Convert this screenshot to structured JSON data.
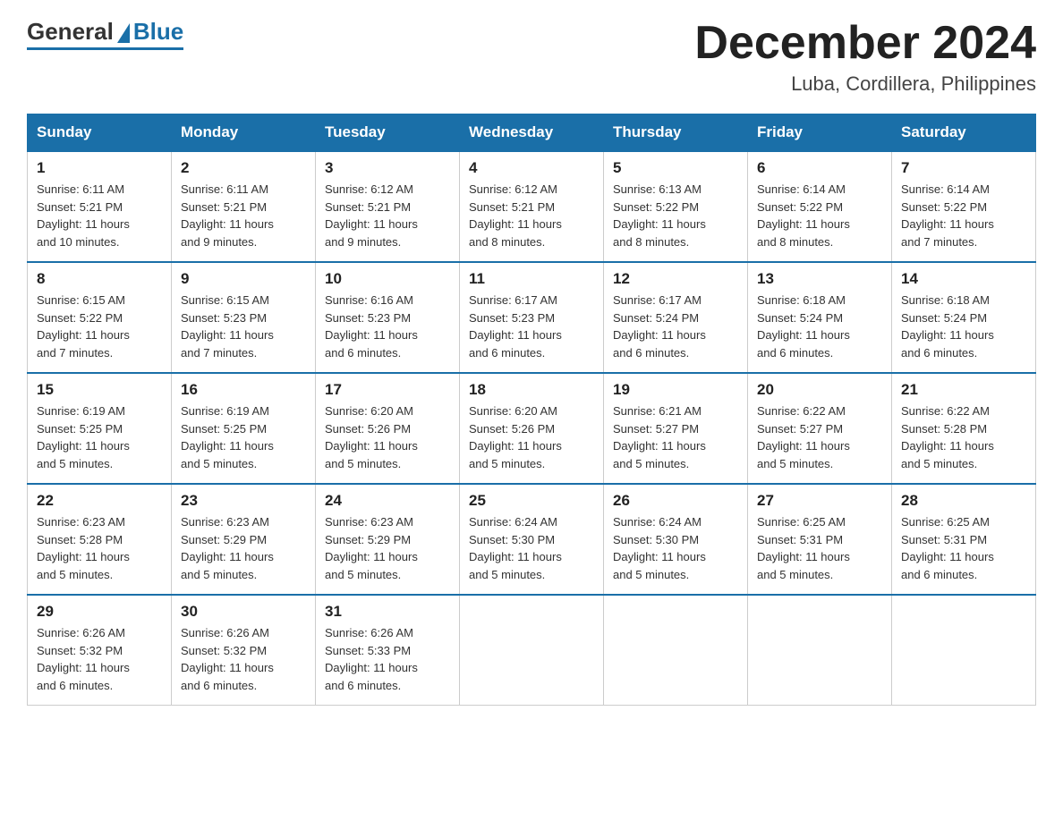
{
  "logo": {
    "general": "General",
    "blue": "Blue"
  },
  "header": {
    "month": "December 2024",
    "location": "Luba, Cordillera, Philippines"
  },
  "days_of_week": [
    "Sunday",
    "Monday",
    "Tuesday",
    "Wednesday",
    "Thursday",
    "Friday",
    "Saturday"
  ],
  "weeks": [
    [
      {
        "day": "1",
        "sunrise": "6:11 AM",
        "sunset": "5:21 PM",
        "daylight": "11 hours and 10 minutes."
      },
      {
        "day": "2",
        "sunrise": "6:11 AM",
        "sunset": "5:21 PM",
        "daylight": "11 hours and 9 minutes."
      },
      {
        "day": "3",
        "sunrise": "6:12 AM",
        "sunset": "5:21 PM",
        "daylight": "11 hours and 9 minutes."
      },
      {
        "day": "4",
        "sunrise": "6:12 AM",
        "sunset": "5:21 PM",
        "daylight": "11 hours and 8 minutes."
      },
      {
        "day": "5",
        "sunrise": "6:13 AM",
        "sunset": "5:22 PM",
        "daylight": "11 hours and 8 minutes."
      },
      {
        "day": "6",
        "sunrise": "6:14 AM",
        "sunset": "5:22 PM",
        "daylight": "11 hours and 8 minutes."
      },
      {
        "day": "7",
        "sunrise": "6:14 AM",
        "sunset": "5:22 PM",
        "daylight": "11 hours and 7 minutes."
      }
    ],
    [
      {
        "day": "8",
        "sunrise": "6:15 AM",
        "sunset": "5:22 PM",
        "daylight": "11 hours and 7 minutes."
      },
      {
        "day": "9",
        "sunrise": "6:15 AM",
        "sunset": "5:23 PM",
        "daylight": "11 hours and 7 minutes."
      },
      {
        "day": "10",
        "sunrise": "6:16 AM",
        "sunset": "5:23 PM",
        "daylight": "11 hours and 6 minutes."
      },
      {
        "day": "11",
        "sunrise": "6:17 AM",
        "sunset": "5:23 PM",
        "daylight": "11 hours and 6 minutes."
      },
      {
        "day": "12",
        "sunrise": "6:17 AM",
        "sunset": "5:24 PM",
        "daylight": "11 hours and 6 minutes."
      },
      {
        "day": "13",
        "sunrise": "6:18 AM",
        "sunset": "5:24 PM",
        "daylight": "11 hours and 6 minutes."
      },
      {
        "day": "14",
        "sunrise": "6:18 AM",
        "sunset": "5:24 PM",
        "daylight": "11 hours and 6 minutes."
      }
    ],
    [
      {
        "day": "15",
        "sunrise": "6:19 AM",
        "sunset": "5:25 PM",
        "daylight": "11 hours and 5 minutes."
      },
      {
        "day": "16",
        "sunrise": "6:19 AM",
        "sunset": "5:25 PM",
        "daylight": "11 hours and 5 minutes."
      },
      {
        "day": "17",
        "sunrise": "6:20 AM",
        "sunset": "5:26 PM",
        "daylight": "11 hours and 5 minutes."
      },
      {
        "day": "18",
        "sunrise": "6:20 AM",
        "sunset": "5:26 PM",
        "daylight": "11 hours and 5 minutes."
      },
      {
        "day": "19",
        "sunrise": "6:21 AM",
        "sunset": "5:27 PM",
        "daylight": "11 hours and 5 minutes."
      },
      {
        "day": "20",
        "sunrise": "6:22 AM",
        "sunset": "5:27 PM",
        "daylight": "11 hours and 5 minutes."
      },
      {
        "day": "21",
        "sunrise": "6:22 AM",
        "sunset": "5:28 PM",
        "daylight": "11 hours and 5 minutes."
      }
    ],
    [
      {
        "day": "22",
        "sunrise": "6:23 AM",
        "sunset": "5:28 PM",
        "daylight": "11 hours and 5 minutes."
      },
      {
        "day": "23",
        "sunrise": "6:23 AM",
        "sunset": "5:29 PM",
        "daylight": "11 hours and 5 minutes."
      },
      {
        "day": "24",
        "sunrise": "6:23 AM",
        "sunset": "5:29 PM",
        "daylight": "11 hours and 5 minutes."
      },
      {
        "day": "25",
        "sunrise": "6:24 AM",
        "sunset": "5:30 PM",
        "daylight": "11 hours and 5 minutes."
      },
      {
        "day": "26",
        "sunrise": "6:24 AM",
        "sunset": "5:30 PM",
        "daylight": "11 hours and 5 minutes."
      },
      {
        "day": "27",
        "sunrise": "6:25 AM",
        "sunset": "5:31 PM",
        "daylight": "11 hours and 5 minutes."
      },
      {
        "day": "28",
        "sunrise": "6:25 AM",
        "sunset": "5:31 PM",
        "daylight": "11 hours and 6 minutes."
      }
    ],
    [
      {
        "day": "29",
        "sunrise": "6:26 AM",
        "sunset": "5:32 PM",
        "daylight": "11 hours and 6 minutes."
      },
      {
        "day": "30",
        "sunrise": "6:26 AM",
        "sunset": "5:32 PM",
        "daylight": "11 hours and 6 minutes."
      },
      {
        "day": "31",
        "sunrise": "6:26 AM",
        "sunset": "5:33 PM",
        "daylight": "11 hours and 6 minutes."
      },
      null,
      null,
      null,
      null
    ]
  ],
  "labels": {
    "sunrise": "Sunrise:",
    "sunset": "Sunset:",
    "daylight": "Daylight:"
  }
}
